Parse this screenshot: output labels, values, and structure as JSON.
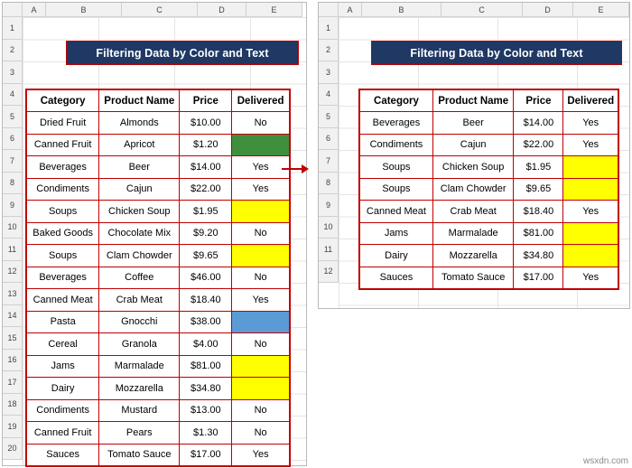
{
  "left_sheet": {
    "column_headers": [
      "A",
      "B",
      "C",
      "D",
      "E"
    ],
    "row_headers": [
      "1",
      "2",
      "3",
      "4",
      "5",
      "6",
      "7",
      "8",
      "9",
      "10",
      "11",
      "12",
      "13",
      "14",
      "15",
      "16",
      "17",
      "18",
      "19",
      "20"
    ],
    "banner_title": "Filtering Data by Color and Text",
    "table": {
      "headers": [
        "Category",
        "Product Name",
        "Price",
        "Delivered"
      ],
      "rows": [
        {
          "category": "Dried Fruit",
          "product": "Almonds",
          "price": "$10.00",
          "delivered": "No",
          "fill": ""
        },
        {
          "category": "Canned Fruit",
          "product": "Apricot",
          "price": "$1.20",
          "delivered": "",
          "fill": "green"
        },
        {
          "category": "Beverages",
          "product": "Beer",
          "price": "$14.00",
          "delivered": "Yes",
          "fill": ""
        },
        {
          "category": "Condiments",
          "product": "Cajun",
          "price": "$22.00",
          "delivered": "Yes",
          "fill": ""
        },
        {
          "category": "Soups",
          "product": "Chicken Soup",
          "price": "$1.95",
          "delivered": "",
          "fill": "yellow"
        },
        {
          "category": "Baked Goods",
          "product": "Chocolate Mix",
          "price": "$9.20",
          "delivered": "No",
          "fill": ""
        },
        {
          "category": "Soups",
          "product": "Clam Chowder",
          "price": "$9.65",
          "delivered": "",
          "fill": "yellow"
        },
        {
          "category": "Beverages",
          "product": "Coffee",
          "price": "$46.00",
          "delivered": "No",
          "fill": ""
        },
        {
          "category": "Canned Meat",
          "product": "Crab Meat",
          "price": "$18.40",
          "delivered": "Yes",
          "fill": ""
        },
        {
          "category": "Pasta",
          "product": "Gnocchi",
          "price": "$38.00",
          "delivered": "",
          "fill": "blue"
        },
        {
          "category": "Cereal",
          "product": "Granola",
          "price": "$4.00",
          "delivered": "No",
          "fill": ""
        },
        {
          "category": "Jams",
          "product": "Marmalade",
          "price": "$81.00",
          "delivered": "",
          "fill": "yellow"
        },
        {
          "category": "Dairy",
          "product": "Mozzarella",
          "price": "$34.80",
          "delivered": "",
          "fill": "yellow"
        },
        {
          "category": "Condiments",
          "product": "Mustard",
          "price": "$13.00",
          "delivered": "No",
          "fill": ""
        },
        {
          "category": "Canned Fruit",
          "product": "Pears",
          "price": "$1.30",
          "delivered": "No",
          "fill": ""
        },
        {
          "category": "Sauces",
          "product": "Tomato Sauce",
          "price": "$17.00",
          "delivered": "Yes",
          "fill": ""
        }
      ]
    }
  },
  "right_sheet": {
    "column_headers": [
      "A",
      "B",
      "C",
      "D",
      "E"
    ],
    "row_headers": [
      "1",
      "2",
      "3",
      "4",
      "5",
      "6",
      "7",
      "8",
      "9",
      "10",
      "11",
      "12"
    ],
    "banner_title": "Filtering Data by Color and Text",
    "table": {
      "headers": [
        "Category",
        "Product Name",
        "Price",
        "Delivered"
      ],
      "rows": [
        {
          "category": "Beverages",
          "product": "Beer",
          "price": "$14.00",
          "delivered": "Yes",
          "fill": ""
        },
        {
          "category": "Condiments",
          "product": "Cajun",
          "price": "$22.00",
          "delivered": "Yes",
          "fill": ""
        },
        {
          "category": "Soups",
          "product": "Chicken Soup",
          "price": "$1.95",
          "delivered": "",
          "fill": "yellow"
        },
        {
          "category": "Soups",
          "product": "Clam Chowder",
          "price": "$9.65",
          "delivered": "",
          "fill": "yellow"
        },
        {
          "category": "Canned Meat",
          "product": "Crab Meat",
          "price": "$18.40",
          "delivered": "Yes",
          "fill": ""
        },
        {
          "category": "Jams",
          "product": "Marmalade",
          "price": "$81.00",
          "delivered": "",
          "fill": "yellow"
        },
        {
          "category": "Dairy",
          "product": "Mozzarella",
          "price": "$34.80",
          "delivered": "",
          "fill": "yellow"
        },
        {
          "category": "Sauces",
          "product": "Tomato Sauce",
          "price": "$17.00",
          "delivered": "Yes",
          "fill": ""
        }
      ]
    }
  },
  "watermark": "wsxdn.com",
  "colors": {
    "banner_bg": "#1f3864",
    "table_border": "#c00000",
    "highlight_yellow": "#ffff00",
    "highlight_green": "#3f8f3f",
    "highlight_blue": "#5b9bd5"
  }
}
